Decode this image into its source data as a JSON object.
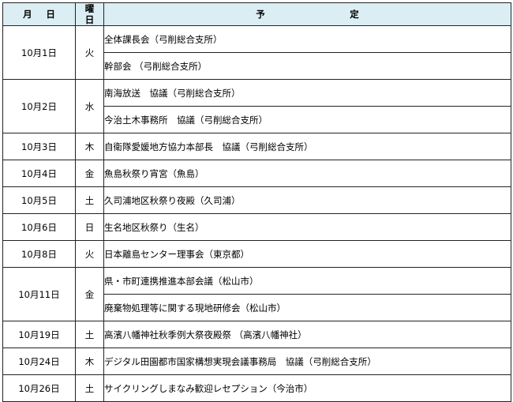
{
  "header": {
    "date": "月 日",
    "dow": "曜 日",
    "plan": "予 定"
  },
  "rows": [
    {
      "date": "10月1日",
      "dow": "火",
      "plans": [
        "全体課長会（弓削総合支所）",
        "幹部会 （弓削総合支所）"
      ]
    },
    {
      "date": "10月2日",
      "dow": "水",
      "plans": [
        "南海放送　協議（弓削総合支所）",
        "今治土木事務所　協議（弓削総合支所）"
      ]
    },
    {
      "date": "10月3日",
      "dow": "木",
      "plans": [
        "自衛隊愛媛地方協力本部長　協議（弓削総合支所）"
      ]
    },
    {
      "date": "10月4日",
      "dow": "金",
      "plans": [
        "魚島秋祭り宵宮（魚島）"
      ]
    },
    {
      "date": "10月5日",
      "dow": "土",
      "plans": [
        "久司浦地区秋祭り夜殿（久司浦）"
      ]
    },
    {
      "date": "10月6日",
      "dow": "日",
      "plans": [
        "生名地区秋祭り（生名）"
      ]
    },
    {
      "date": "10月8日",
      "dow": "火",
      "plans": [
        "日本離島センター理事会（東京都）"
      ]
    },
    {
      "date": "10月11日",
      "dow": "金",
      "plans": [
        "県・市町連携推進本部会議（松山市）",
        "廃棄物処理等に関する現地研修会（松山市）"
      ]
    },
    {
      "date": "10月19日",
      "dow": "土",
      "plans": [
        "高濱八幡神社秋季例大祭夜殿祭 （高濱八幡神社）"
      ]
    },
    {
      "date": "10月24日",
      "dow": "木",
      "plans": [
        "デジタル田園都市国家構想実現会議事務局　協議（弓削総合支所）"
      ]
    },
    {
      "date": "10月26日",
      "dow": "土",
      "plans": [
        "サイクリングしまなみ歓迎レセプション（今治市）"
      ]
    }
  ]
}
